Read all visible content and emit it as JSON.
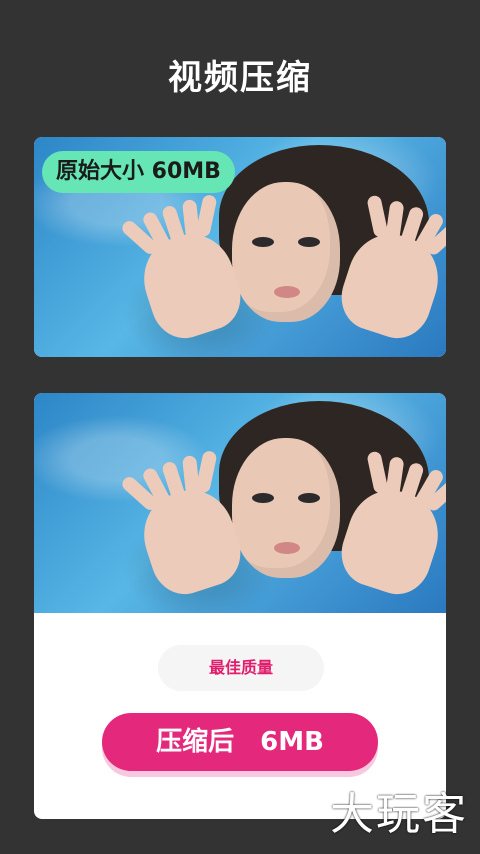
{
  "header": {
    "title": "视频压缩"
  },
  "original_card": {
    "badge": "原始大小 60MB"
  },
  "compressed_card": {
    "quality_label": "最佳质量",
    "result_prefix": "压缩后",
    "result_size": "6MB"
  },
  "watermark": {
    "text": "大玩客"
  },
  "colors": {
    "background": "#333333",
    "badge_green": "#66e6b4",
    "accent_pink": "#e4287b",
    "water_blue": "#2d86c7"
  },
  "icons": []
}
